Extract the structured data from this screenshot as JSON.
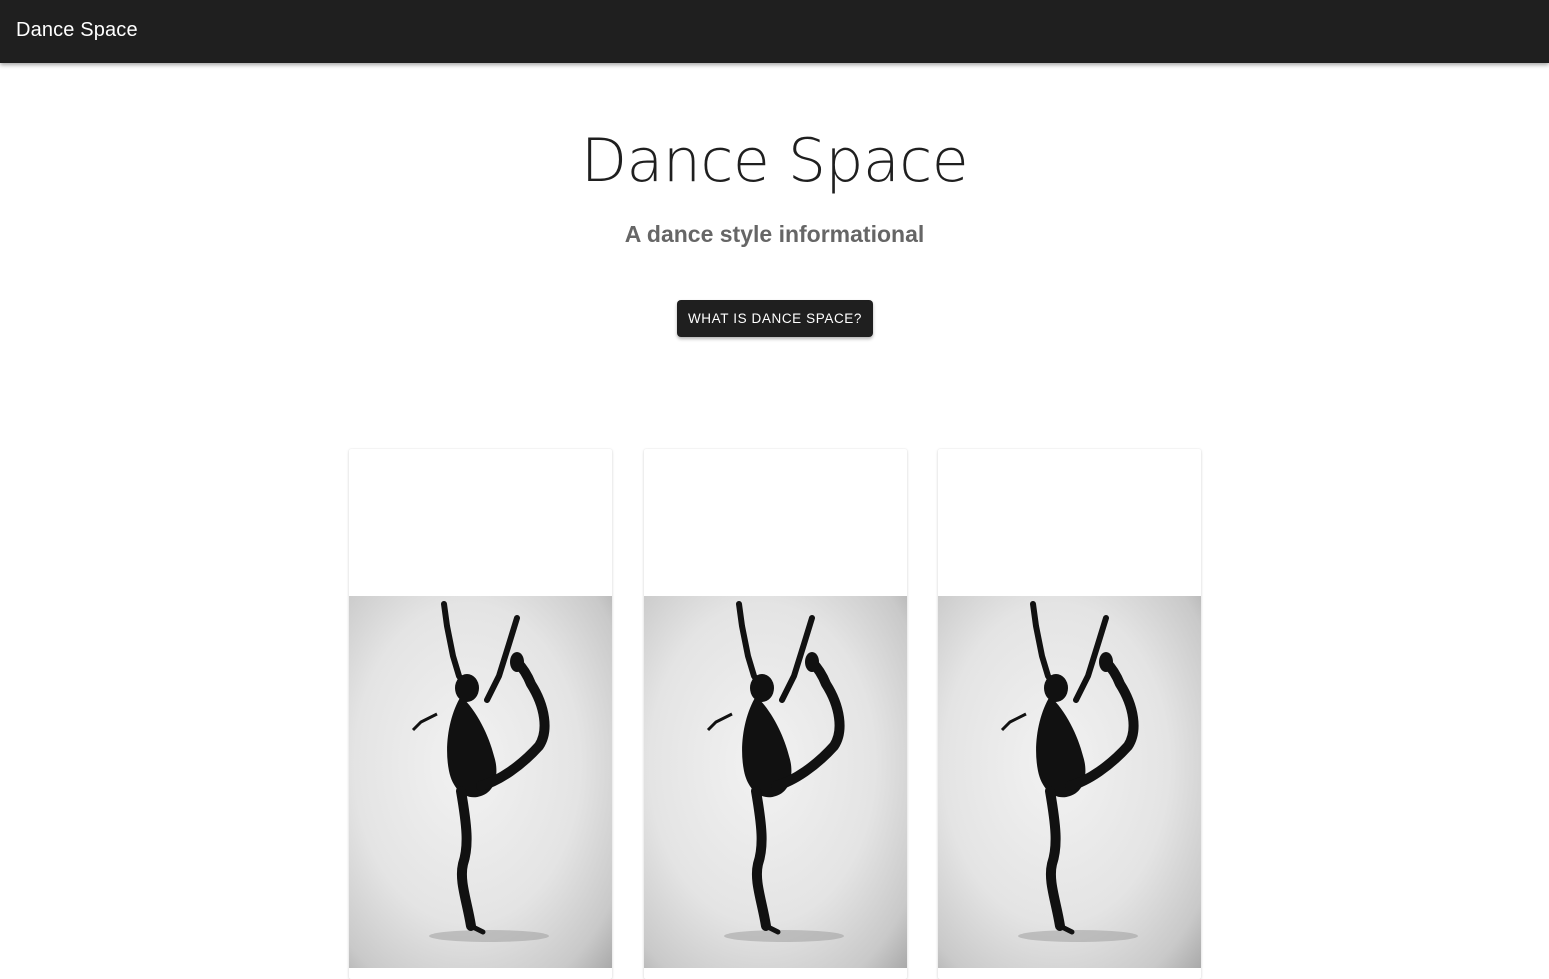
{
  "appbar": {
    "title": "Dance Space"
  },
  "hero": {
    "title": "Dance Space",
    "subtitle": "A dance style informational",
    "button_label": "WHAT IS DANCE SPACE?"
  },
  "cards": [
    {
      "image": "dancer-silhouette"
    },
    {
      "image": "dancer-silhouette"
    },
    {
      "image": "dancer-silhouette"
    }
  ],
  "colors": {
    "appbar_bg": "#1f1f1f",
    "button_bg": "#1f1f1f",
    "subtitle": "#666666"
  }
}
